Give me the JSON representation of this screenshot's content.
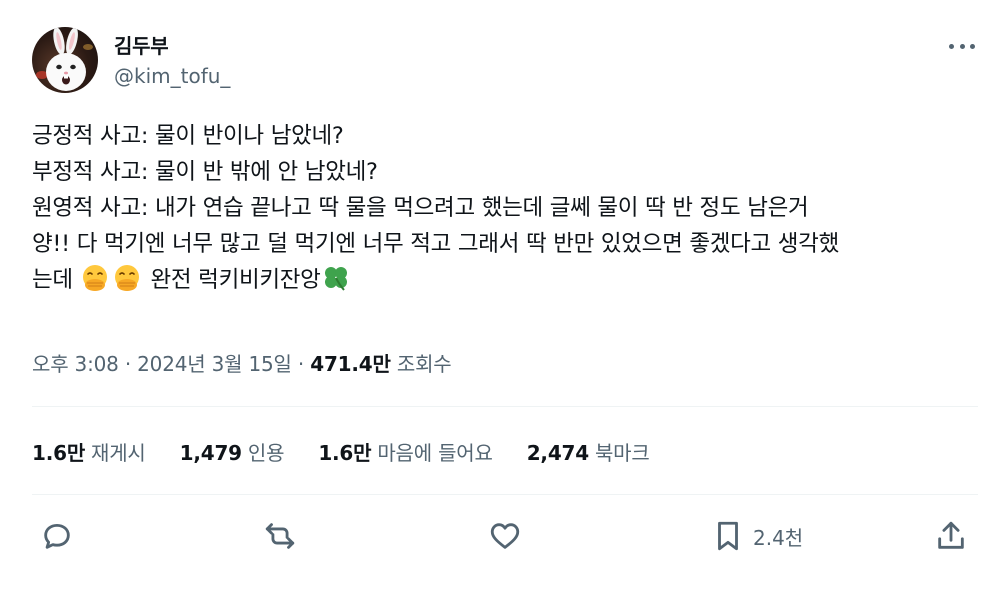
{
  "author": {
    "display_name": "김두부",
    "handle": "@kim_tofu_"
  },
  "tweet": {
    "lines": [
      "긍정적 사고: 물이 반이나 남았네?",
      "부정적 사고: 물이 반 밖에 안 남았네?",
      "원영적 사고: 내가 연습 끝나고 딱 물을 먹으려고 했는데 글쎄 물이 딱 반 정도 남은거",
      "양!! 다 먹기엔 너무 많고 덜 먹기엔 너무 적고 그래서 딱 반만 있었으면 좋겠다고 생각했"
    ],
    "last_line_prefix": "는데",
    "last_line_suffix": " 완전 럭키비키잔앙",
    "emojis": [
      "face-with-hand-over-mouth-icon",
      "face-with-hand-over-mouth-icon",
      "four-leaf-clover-icon"
    ]
  },
  "meta": {
    "time": "오후 3:08",
    "separator": " · ",
    "date": "2024년 3월 15일",
    "views_count": "471.4만",
    "views_label": "조회수"
  },
  "stats": {
    "reposts": {
      "num": "1.6만",
      "label": "재게시"
    },
    "quotes": {
      "num": "1,479",
      "label": "인용"
    },
    "likes": {
      "num": "1.6만",
      "label": "마음에 들어요"
    },
    "bookmarks": {
      "num": "2,474",
      "label": "북마크"
    }
  },
  "actions": {
    "bookmark_count": "2.4천"
  },
  "colors": {
    "text": "#0f1419",
    "secondary": "#536471",
    "divider": "#eff3f4"
  }
}
